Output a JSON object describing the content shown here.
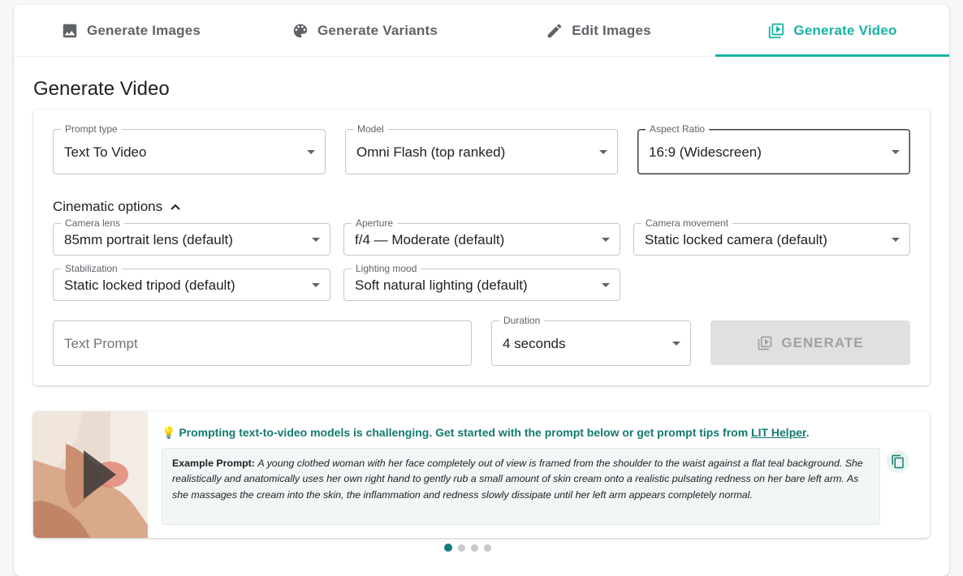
{
  "tabs": [
    {
      "label": "Generate Images",
      "icon": "image-icon",
      "active": false
    },
    {
      "label": "Generate Variants",
      "icon": "palette-icon",
      "active": false
    },
    {
      "label": "Edit Images",
      "icon": "pencil-icon",
      "active": false
    },
    {
      "label": "Generate Video",
      "icon": "video-library-icon",
      "active": true
    }
  ],
  "page_title": "Generate Video",
  "fields": {
    "prompt_type": {
      "label": "Prompt type",
      "value": "Text To Video"
    },
    "model": {
      "label": "Model",
      "value": "Omni Flash (top ranked)"
    },
    "aspect_ratio": {
      "label": "Aspect Ratio",
      "value": "16:9 (Widescreen)"
    }
  },
  "cinematic": {
    "toggle_label": "Cinematic options",
    "camera_lens": {
      "label": "Camera lens",
      "value": "85mm portrait lens (default)"
    },
    "aperture": {
      "label": "Aperture",
      "value": "f/4 — Moderate (default)"
    },
    "camera_movement": {
      "label": "Camera movement",
      "value": "Static locked camera (default)"
    },
    "stabilization": {
      "label": "Stabilization",
      "value": "Static locked tripod (default)"
    },
    "lighting_mood": {
      "label": "Lighting mood",
      "value": "Soft natural lighting (default)"
    }
  },
  "text_prompt": {
    "placeholder": "Text Prompt",
    "value": ""
  },
  "duration": {
    "label": "Duration",
    "value": "4 seconds"
  },
  "generate_button": {
    "label": "GENERATE",
    "enabled": false
  },
  "tip": {
    "heading_prefix": "💡",
    "heading": "Prompting text-to-video models is challenging. Get started with the prompt below or get prompt tips from ",
    "link": "LIT Helper",
    "heading_suffix": ".",
    "example_label": "Example Prompt:",
    "example_text": "A young clothed woman with her face completely out of view is framed from the shoulder to the waist against a flat teal background. She realistically and anatomically uses her own right hand to gently rub a small amount of skin cream onto a realistic pulsating redness on her bare left arm. As she massages the cream into the skin, the inflammation and redness slowly dissipate until her left arm appears completely normal."
  },
  "carousel": {
    "count": 4,
    "active_index": 0
  },
  "colors": {
    "accent": "#17b3a3",
    "tip_text": "#137a6f",
    "disabled_bg": "#e0e0e0"
  }
}
